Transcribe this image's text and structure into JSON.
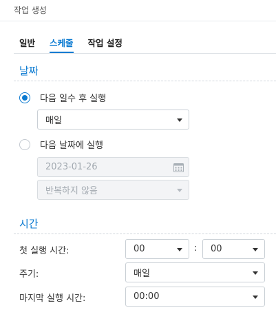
{
  "window": {
    "title": "작업 생성"
  },
  "tabs": [
    {
      "label": "일반",
      "active": false
    },
    {
      "label": "스케줄",
      "active": true
    },
    {
      "label": "작업 설정",
      "active": false
    }
  ],
  "date_section": {
    "title": "날짜",
    "option_days": {
      "label": "다음 일수 후 실행",
      "checked": true,
      "select_value": "매일"
    },
    "option_date": {
      "label": "다음 날짜에 실행",
      "checked": false,
      "date_value": "2023-01-26",
      "repeat_value": "반복하지 않음"
    }
  },
  "time_section": {
    "title": "시간",
    "first_run_label": "첫 실행 시간:",
    "first_run_hour": "00",
    "colon": ":",
    "first_run_minute": "00",
    "frequency_label": "주기:",
    "frequency_value": "매일",
    "last_run_label": "마지막 실행 시간:",
    "last_run_value": "00:00"
  },
  "colors": {
    "accent": "#0b7ad1",
    "text": "#333333",
    "border": "#c9cfd5"
  },
  "icons": {
    "dropdown": "chevron-down-icon",
    "date_picker": "calendar-icon"
  }
}
